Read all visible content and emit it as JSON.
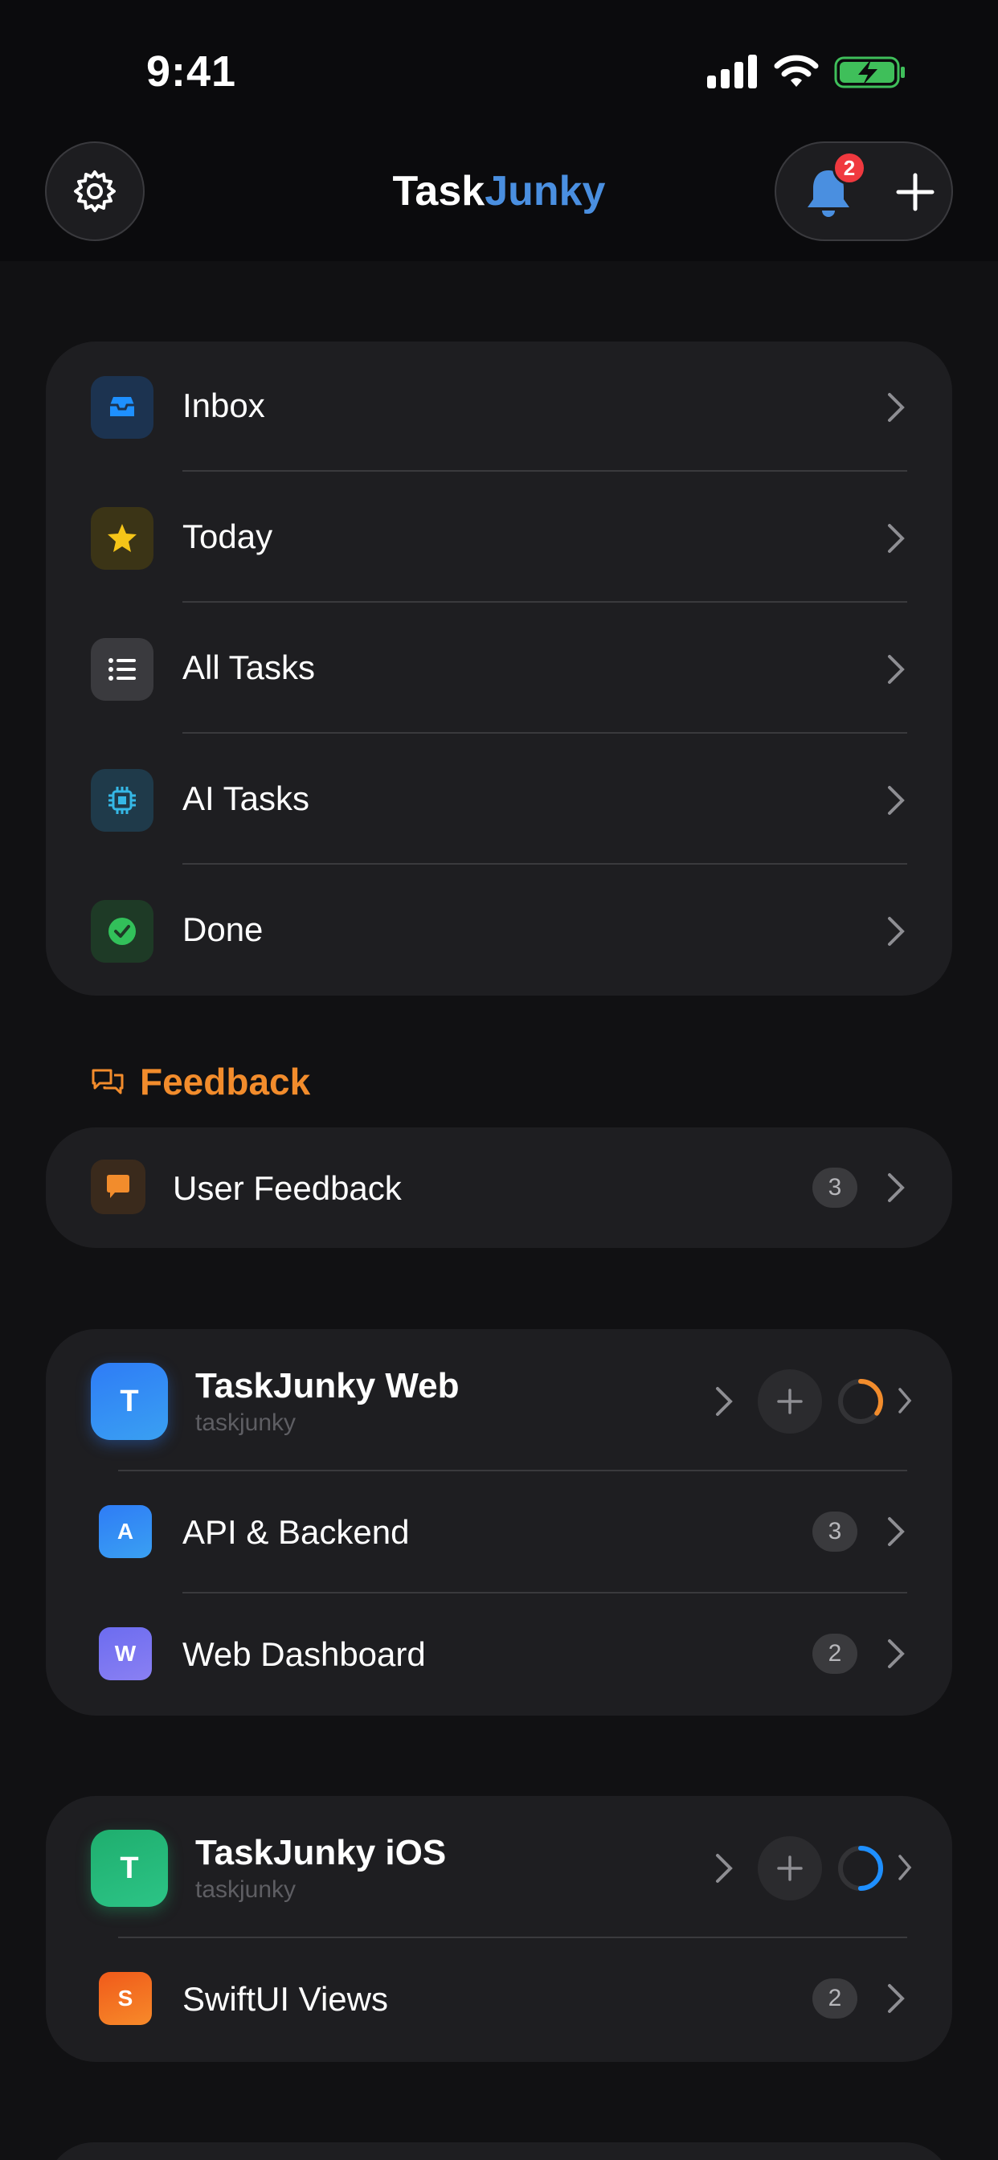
{
  "status_bar": {
    "time": "9:41"
  },
  "header": {
    "title_part1": "Task",
    "title_part2": "Junky",
    "notification_count": "2"
  },
  "nav_list": {
    "items": [
      {
        "label": "Inbox",
        "icon": "tray-icon"
      },
      {
        "label": "Today",
        "icon": "star-icon"
      },
      {
        "label": "All Tasks",
        "icon": "list-icon"
      },
      {
        "label": "AI Tasks",
        "icon": "cpu-icon"
      },
      {
        "label": "Done",
        "icon": "checkmark-circle-icon"
      }
    ]
  },
  "feedback_section": {
    "title": "Feedback",
    "item": {
      "label": "User Feedback",
      "count": "3"
    }
  },
  "projects": [
    {
      "initial": "T",
      "name": "TaskJunky Web",
      "subtitle": "taskjunky",
      "progress": 0.35,
      "children": [
        {
          "initial": "A",
          "label": "API & Backend",
          "count": "3"
        },
        {
          "initial": "W",
          "label": "Web Dashboard",
          "count": "2"
        }
      ]
    },
    {
      "initial": "T",
      "name": "TaskJunky iOS",
      "subtitle": "taskjunky",
      "progress": 0.5,
      "children": [
        {
          "initial": "S",
          "label": "SwiftUI Views",
          "count": "2"
        }
      ]
    }
  ],
  "colors": {
    "background": "#111113",
    "card": "#1e1e21",
    "accent_blue": "#4a8fe0",
    "accent_orange": "#f28c2c",
    "badge_red": "#f0393f"
  }
}
